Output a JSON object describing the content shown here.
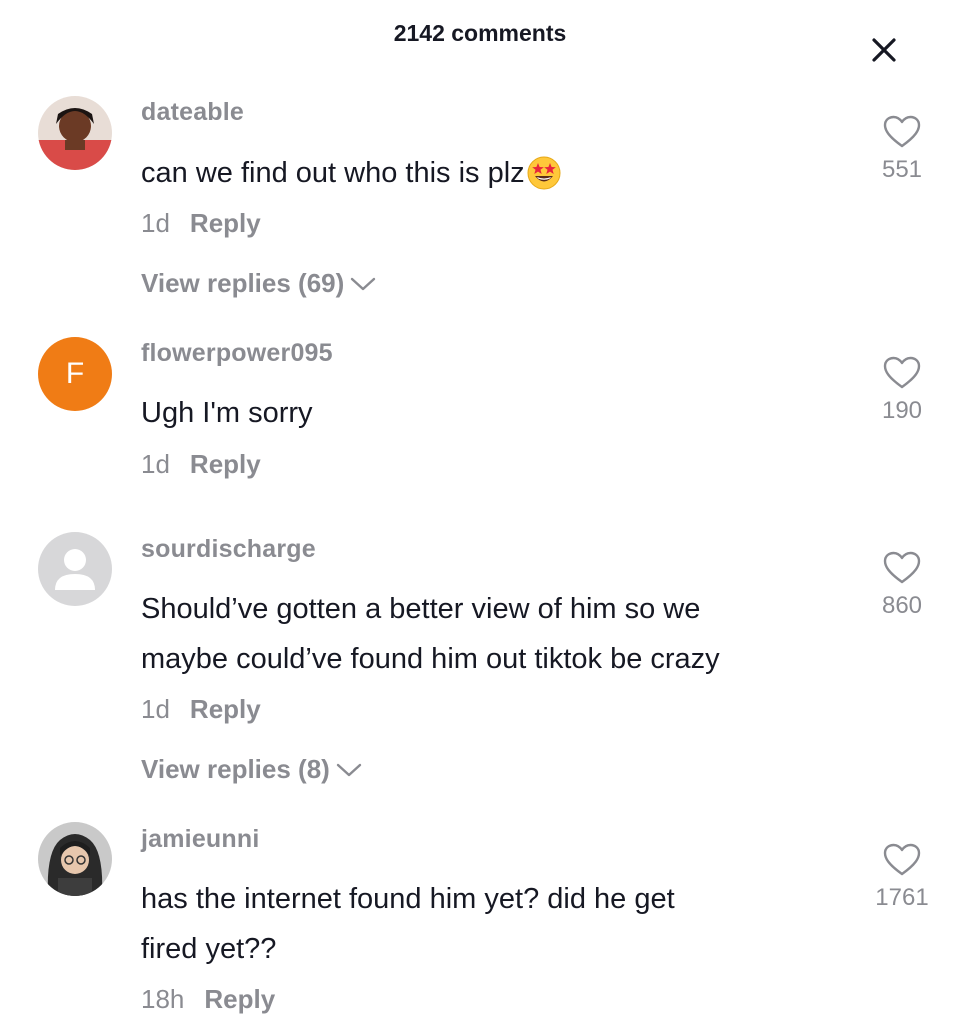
{
  "header": {
    "title": "2142 comments",
    "close_icon": "close-icon"
  },
  "comments": [
    {
      "username": "dateable",
      "text": "can we find out who this is plz",
      "emoji": "star-struck-emoji",
      "time": "1d",
      "reply_label": "Reply",
      "likes": "551",
      "view_replies": "View replies (69)"
    },
    {
      "username": "flowerpower095",
      "avatar_letter": "F",
      "text": "Ugh I'm sorry",
      "time": "1d",
      "reply_label": "Reply",
      "likes": "190"
    },
    {
      "username": "sourdischarge",
      "text_lines": [
        "Should’ve gotten a better view of him so we",
        "maybe could’ve found him out tiktok be crazy"
      ],
      "time": "1d",
      "reply_label": "Reply",
      "likes": "860",
      "view_replies": "View replies (8)"
    },
    {
      "username": "jamieunni",
      "text_lines": [
        "has the internet found him yet? did he get",
        "fired yet??"
      ],
      "time": "18h",
      "reply_label": "Reply",
      "likes": "1761"
    }
  ],
  "colors": {
    "muted": "#8a8b91",
    "text": "#161823",
    "avatar_orange": "#f07c15"
  }
}
